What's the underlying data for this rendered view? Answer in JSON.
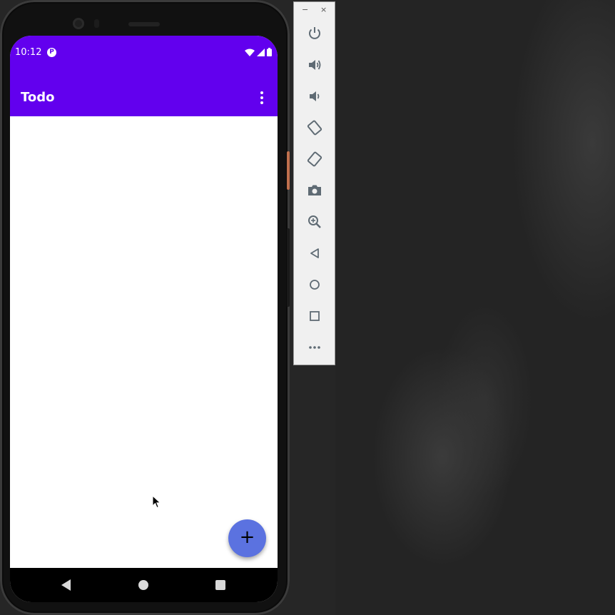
{
  "statusbar": {
    "time": "10:12",
    "app_icon_glyph": "P"
  },
  "appbar": {
    "title": "Todo",
    "overflow_icon": "more-vert-icon"
  },
  "fab": {
    "label": "+"
  },
  "colors": {
    "primary": "#6200ee",
    "fab": "#5b72e0",
    "icon_gray": "#5f6b74"
  },
  "emulator": {
    "window_controls": {
      "minimize": "−",
      "close": "×"
    },
    "tools": [
      {
        "name": "power-icon"
      },
      {
        "name": "volume-up-icon"
      },
      {
        "name": "volume-down-icon"
      },
      {
        "name": "rotate-left-icon"
      },
      {
        "name": "rotate-right-icon"
      },
      {
        "name": "camera-icon"
      },
      {
        "name": "zoom-icon"
      },
      {
        "name": "back-icon"
      },
      {
        "name": "home-icon"
      },
      {
        "name": "overview-icon"
      },
      {
        "name": "more-icon"
      }
    ]
  }
}
